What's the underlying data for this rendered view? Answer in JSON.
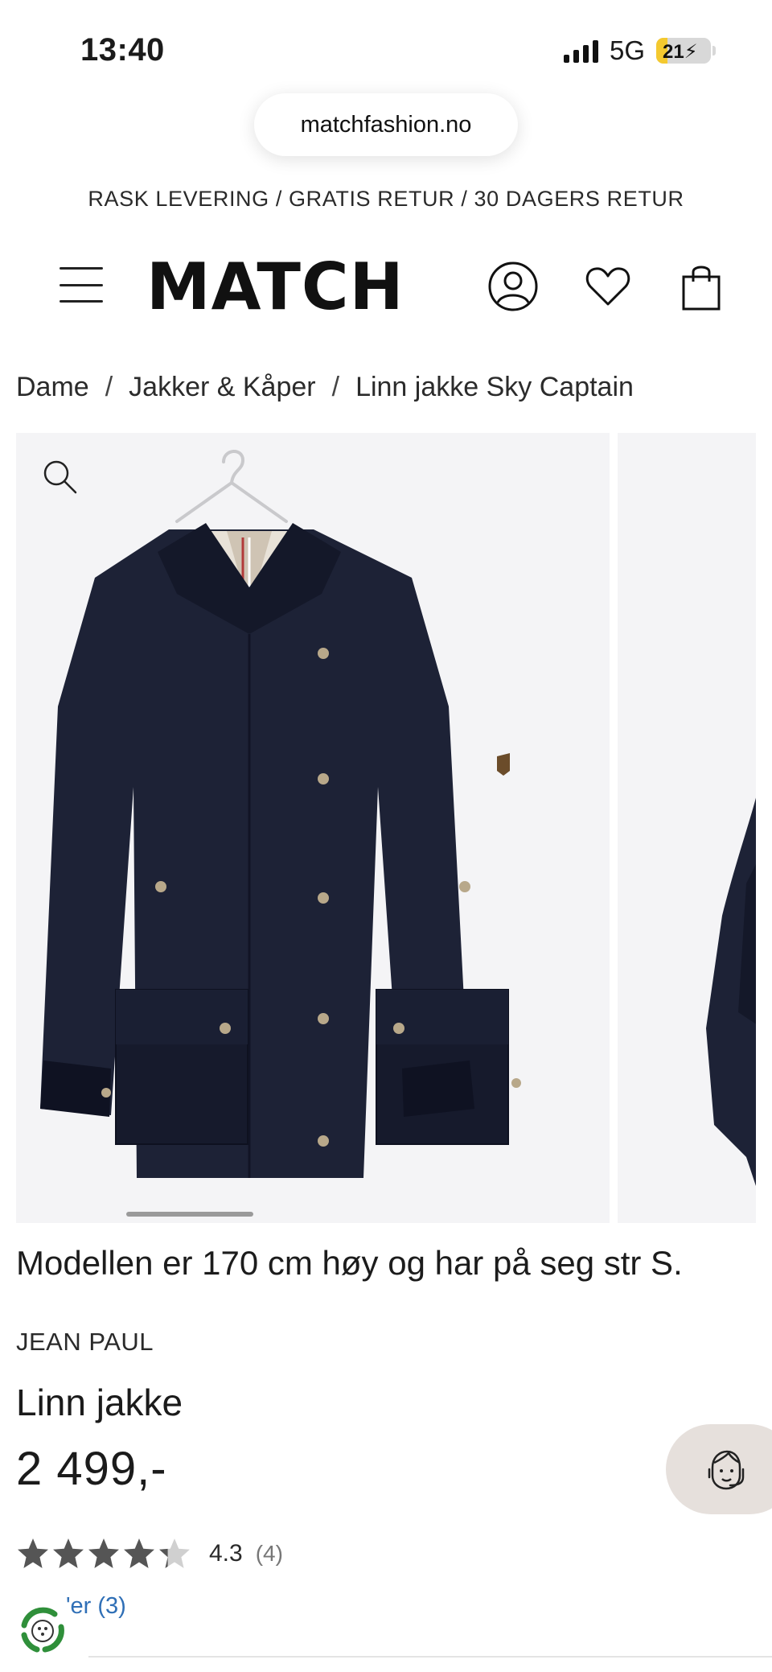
{
  "status_bar": {
    "time": "13:40",
    "network": "5G",
    "battery": "21",
    "battery_level": 0.21
  },
  "browser": {
    "url": "matchfashion.no"
  },
  "promo": {
    "text": "RASK LEVERING / GRATIS RETUR / 30 DAGERS RETUR"
  },
  "header": {
    "logo": "MATCH",
    "icons": [
      "menu-icon",
      "account-icon",
      "heart-icon",
      "shopping-bag-icon"
    ]
  },
  "breadcrumb": {
    "items": [
      "Dame",
      "Jakker & Kåper",
      "Linn jakke Sky Captain"
    ],
    "separator": "/"
  },
  "product": {
    "model_info": "Modellen er 170 cm høy og har på seg str S.",
    "brand": "JEAN PAUL",
    "name": "Linn jakke",
    "price": "2 499,-",
    "rating": "4.3",
    "rating_value": 4.3,
    "rating_max": 5,
    "review_count": "(4)",
    "reviews_link": "'er (3)",
    "colors": {
      "jacket": "#1d2236",
      "gallery_bg": "#f4f4f6",
      "chat_bg": "#e6e0dc",
      "link": "#2f6fb6"
    }
  }
}
